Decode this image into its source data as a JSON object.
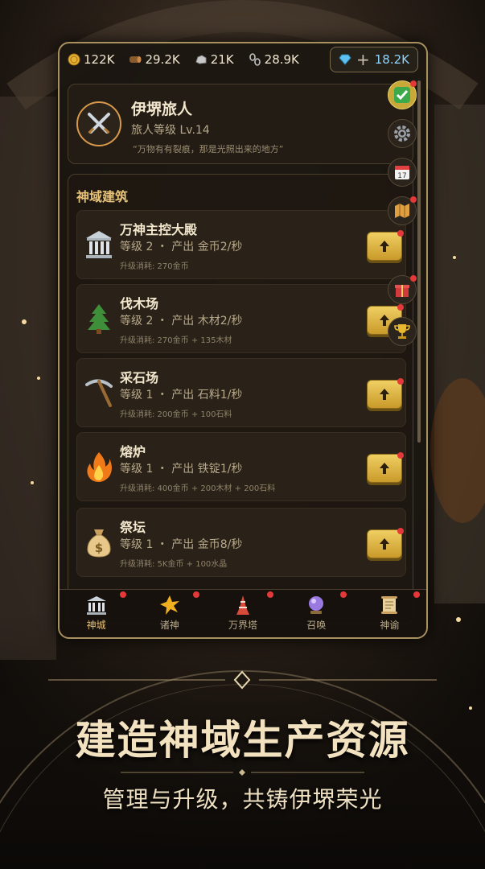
{
  "resources": {
    "gold": "122K",
    "wood": "29.2K",
    "stone": "21K",
    "iron": "28.9K",
    "gems": "18.2K",
    "gem_plus": "+"
  },
  "profile": {
    "name": "伊堺旅人",
    "level": "旅人等级 Lv.14",
    "quote": "“万物有有裂痕，那是光照出来的地方”"
  },
  "section": {
    "title": "神域建筑"
  },
  "buildings": [
    {
      "name": "万神主控大殿",
      "info": "等级 2 ・ 产出 金币2/秒",
      "cost": "升级消耗: 270金币",
      "icon": "temple-icon"
    },
    {
      "name": "伐木场",
      "info": "等级 2 ・ 产出 木材2/秒",
      "cost": "升级消耗: 270金币 + 135木材",
      "icon": "tree-icon"
    },
    {
      "name": "采石场",
      "info": "等级 1 ・ 产出 石料1/秒",
      "cost": "升级消耗: 200金币 + 100石料",
      "icon": "pickaxe-icon"
    },
    {
      "name": "熔炉",
      "info": "等级 1 ・ 产出 铁锭1/秒",
      "cost": "升级消耗: 400金币 + 200木材 + 200石料",
      "icon": "fire-icon"
    },
    {
      "name": "祭坛",
      "info": "等级 1 ・ 产出 金币8/秒",
      "cost": "升级消耗: 5K金币 + 100水晶",
      "icon": "money-bag-icon"
    }
  ],
  "side_buttons": {
    "calendar_day": "17"
  },
  "nav": [
    {
      "label": "神城"
    },
    {
      "label": "诸神"
    },
    {
      "label": "万界塔"
    },
    {
      "label": "召唤"
    },
    {
      "label": "神谕"
    }
  ],
  "promo": {
    "headline": "建造神域生产资源",
    "subline": "管理与升级，共铸伊堺荣光"
  },
  "colors": {
    "accent_gold": "#e6c27a",
    "notification_red": "#e53838",
    "gem_blue": "#8fd4ff"
  }
}
